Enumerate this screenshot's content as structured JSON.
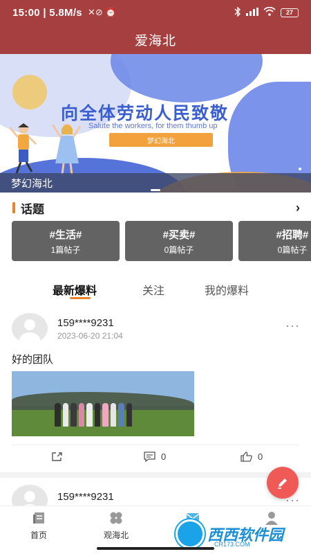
{
  "status_bar": {
    "left": "15:00 | 5.8M/s",
    "icons": "✕⊘ ⏰",
    "battery": "27"
  },
  "header": {
    "title": "爱海北"
  },
  "banner": {
    "main_title": "向全体劳动人民致敬",
    "sub_title": "Salute the workers, for them thumb up",
    "button_label": "梦幻海北",
    "caption": "梦幻海北"
  },
  "topics": {
    "title": "话题",
    "more": "›",
    "items": [
      {
        "name": "#生活#",
        "count": "1篇帖子"
      },
      {
        "name": "#买卖#",
        "count": "0篇帖子"
      },
      {
        "name": "#招聘#",
        "count": "0篇帖子"
      }
    ]
  },
  "tabs": [
    {
      "label": "最新爆料"
    },
    {
      "label": "关注"
    },
    {
      "label": "我的爆料"
    }
  ],
  "posts": [
    {
      "username": "159****9231",
      "time": "2023-06-20 21:04",
      "menu": "···",
      "text": "好的团队",
      "comments": "0",
      "likes": "0"
    },
    {
      "username": "159****9231",
      "menu": "···"
    }
  ],
  "bottom_nav": {
    "items": [
      {
        "label": "首页",
        "icon": "home-icon"
      },
      {
        "label": "观海北",
        "icon": "grid-icon"
      },
      {
        "label": "",
        "icon": "mail-icon"
      },
      {
        "label": "",
        "icon": "user-icon"
      }
    ]
  },
  "watermark": {
    "text": "西西软件园",
    "sub": "CR173.COM"
  },
  "colors": {
    "header": "#a63f3f",
    "accent": "#e8832c",
    "fab": "#ef5a57",
    "topic_card": "#636363"
  }
}
